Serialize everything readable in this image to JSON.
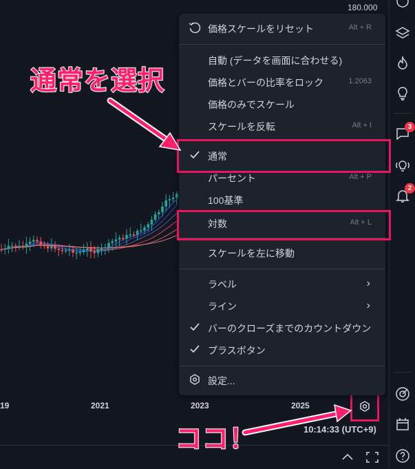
{
  "price_axis": {
    "top_label": "180.000"
  },
  "time_axis": {
    "years": [
      "19",
      "2021",
      "2023",
      "2025"
    ]
  },
  "clock": {
    "time": "10:14:33 (UTC+9)"
  },
  "menu": {
    "reset": {
      "label": "価格スケールをリセット",
      "shortcut": "Alt + R"
    },
    "auto": {
      "label": "自動 (データを画面に合わせる)"
    },
    "lock_ratio": {
      "label": "価格とバーの比率をロック",
      "value": "1.2063"
    },
    "price_only": {
      "label": "価格のみでスケール"
    },
    "invert": {
      "label": "スケールを反転",
      "shortcut": "Alt + I"
    },
    "normal": {
      "label": "通常",
      "checked": true
    },
    "percent": {
      "label": "パーセント",
      "shortcut": "Alt + P"
    },
    "indexed": {
      "label": "100基準"
    },
    "log": {
      "label": "対数",
      "shortcut": "Alt + L"
    },
    "move_left": {
      "label": "スケールを左に移動"
    },
    "labels": {
      "label": "ラベル"
    },
    "lines": {
      "label": "ライン"
    },
    "countdown": {
      "label": "バーのクローズまでのカウントダウン",
      "checked": true
    },
    "plus_button": {
      "label": "プラスボタン",
      "checked": true
    },
    "settings": {
      "label": "設定..."
    }
  },
  "toolbar": {
    "chat_badge": "3",
    "alert_badge": "2"
  },
  "annotations": {
    "select_normal": "通常を選択",
    "here": "ココ！"
  },
  "colors": {
    "background": "#131722",
    "menu_bg": "#1e222d",
    "annotation": "#e8175d",
    "candle_up": "#26a69a",
    "candle_down": "#ef5350"
  },
  "chart_data": {
    "type": "candlestick",
    "x_ticks": [
      "19",
      "2021",
      "2023",
      "2025"
    ],
    "y_top_tick": "180.000"
  }
}
